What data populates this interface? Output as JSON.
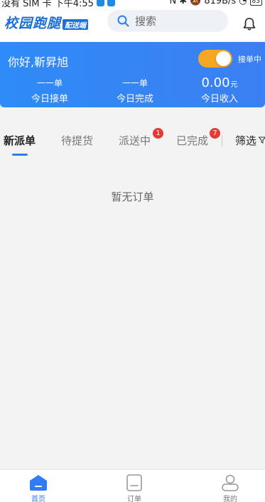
{
  "status_bar": {
    "left_text": "没有 SIM 卡 下午4:55",
    "right_text": "819B/s",
    "battery": "83"
  },
  "header": {
    "logo_main": "校园跑腿",
    "logo_sub": "配送端",
    "search_placeholder": "搜索"
  },
  "banner": {
    "greeting": "你好,靳昇旭",
    "toggle_label": "接单中",
    "toggle_on": true,
    "stats": [
      {
        "value": "一一单",
        "label": "今日接单"
      },
      {
        "value": "一一单",
        "label": "今日完成"
      },
      {
        "value": "0.00",
        "unit": "元",
        "label": "今日收入"
      }
    ]
  },
  "tabs": [
    {
      "label": "新派单",
      "active": true
    },
    {
      "label": "待提货",
      "active": false
    },
    {
      "label": "派送中",
      "active": false,
      "badge": "1"
    },
    {
      "label": "已完成",
      "active": false,
      "badge": "7"
    }
  ],
  "filter_label": "筛选",
  "empty_text": "暂无订单",
  "bottom_nav": [
    {
      "label": "首页",
      "active": true
    },
    {
      "label": "订单",
      "active": false
    },
    {
      "label": "我的",
      "active": false
    }
  ],
  "colors": {
    "primary": "#2f7cf6",
    "toggle_on": "#f5a623",
    "badge": "#e53935"
  }
}
